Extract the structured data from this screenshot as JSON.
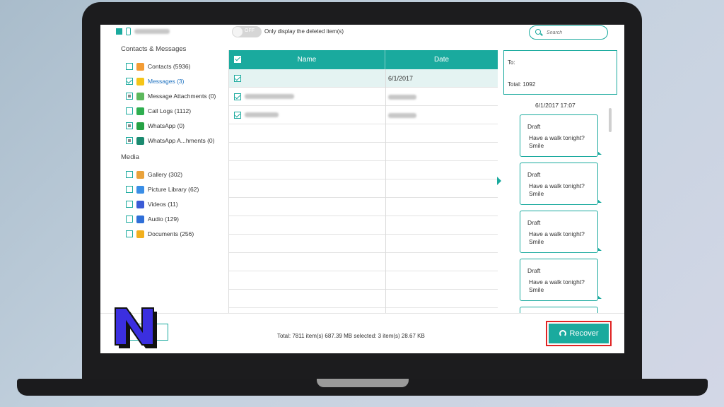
{
  "app": {
    "toggle_state": "OFF",
    "only_deleted_label": "Only display the deleted item(s)",
    "search_placeholder": "Search"
  },
  "sidebar": {
    "contacts_messages_title": "Contacts & Messages",
    "media_title": "Media",
    "contacts_messages": [
      {
        "label": "Contacts (5936)",
        "checked": false,
        "icon": "contacts-icon",
        "color": "#f39c34"
      },
      {
        "label": "Messages (3)",
        "checked": true,
        "icon": "messages-icon",
        "color": "#f5c518"
      },
      {
        "label": "Message Attachments (0)",
        "checked": "partial",
        "icon": "attachment-icon",
        "color": "#5cb85c"
      },
      {
        "label": "Call Logs (1112)",
        "checked": false,
        "icon": "call-log-icon",
        "color": "#2eae4f"
      },
      {
        "label": "WhatsApp (0)",
        "checked": "partial",
        "icon": "whatsapp-icon",
        "color": "#25a244"
      },
      {
        "label": "WhatsApp A...hments (0)",
        "checked": "partial",
        "icon": "whatsapp-attachment-icon",
        "color": "#1b8a6f"
      }
    ],
    "media": [
      {
        "label": "Gallery (302)",
        "checked": false,
        "icon": "gallery-icon",
        "color": "#e9a23b"
      },
      {
        "label": "Picture Library (62)",
        "checked": false,
        "icon": "picture-library-icon",
        "color": "#3a8ee6"
      },
      {
        "label": "Videos (11)",
        "checked": false,
        "icon": "videos-icon",
        "color": "#3b5bd6"
      },
      {
        "label": "Audio (129)",
        "checked": false,
        "icon": "audio-icon",
        "color": "#2f6fd8"
      },
      {
        "label": "Documents (256)",
        "checked": false,
        "icon": "documents-icon",
        "color": "#f2b01e"
      }
    ]
  },
  "table": {
    "headers": {
      "name": "Name",
      "date": "Date"
    },
    "rows": [
      {
        "checked": true,
        "date": "6/1/2017",
        "selected": true
      }
    ]
  },
  "detail": {
    "to_label": "To:",
    "total_label": "Total: 1092",
    "message_time": "6/1/2017 17:07",
    "messages": [
      {
        "title": "Draft",
        "text": "Have a walk tonight? Smile"
      },
      {
        "title": "Draft",
        "text": "Have a walk tonight? Smile"
      },
      {
        "title": "Draft",
        "text": "Have a walk tonight? Smile"
      },
      {
        "title": "Draft",
        "text": "Have a walk tonight? Smile"
      }
    ]
  },
  "footer": {
    "total_text": "Total: 7811 item(s) 687.39 MB   selected: 3 item(s) 28.67 KB",
    "recover_label": "Recover"
  },
  "colors": {
    "accent": "#1aaa9e",
    "highlight_border": "#e02424"
  }
}
